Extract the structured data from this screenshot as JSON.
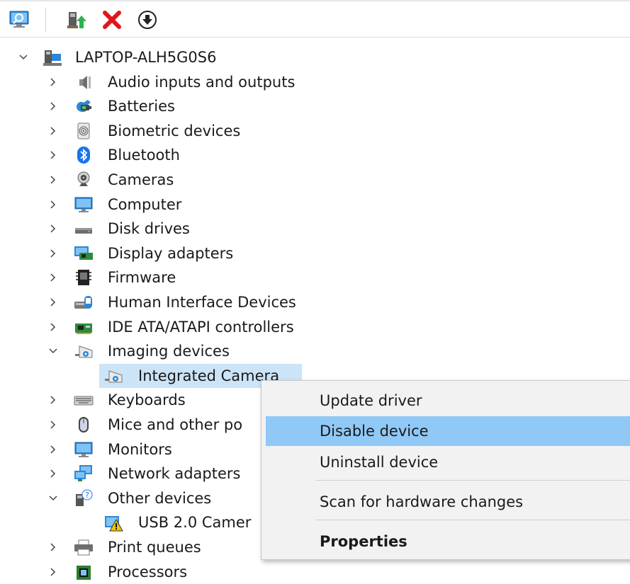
{
  "toolbar": {
    "buttons": [
      {
        "name": "scan-hardware-button",
        "icon": "monitor-magnifier-icon"
      },
      {
        "name": "update-driver-button",
        "icon": "update-driver-icon"
      },
      {
        "name": "uninstall-device-button",
        "icon": "red-x-icon"
      },
      {
        "name": "enable-device-button",
        "icon": "down-arrow-circle-icon"
      }
    ]
  },
  "tree": {
    "root": {
      "label": "LAPTOP-ALH5G0S6",
      "expanded": true,
      "icon": "computer-icon"
    },
    "items": [
      {
        "label": "Audio inputs and outputs",
        "icon": "speaker-icon",
        "expanded": false
      },
      {
        "label": "Batteries",
        "icon": "battery-icon",
        "expanded": false
      },
      {
        "label": "Biometric devices",
        "icon": "fingerprint-icon",
        "expanded": false
      },
      {
        "label": "Bluetooth",
        "icon": "bluetooth-icon",
        "expanded": false
      },
      {
        "label": "Cameras",
        "icon": "webcam-icon",
        "expanded": false
      },
      {
        "label": "Computer",
        "icon": "monitor-icon",
        "expanded": false
      },
      {
        "label": "Disk drives",
        "icon": "disk-drive-icon",
        "expanded": false
      },
      {
        "label": "Display adapters",
        "icon": "display-adapter-icon",
        "expanded": false
      },
      {
        "label": "Firmware",
        "icon": "chip-icon",
        "expanded": false
      },
      {
        "label": "Human Interface Devices",
        "icon": "hid-icon",
        "expanded": false
      },
      {
        "label": "IDE ATA/ATAPI controllers",
        "icon": "controller-card-icon",
        "expanded": false
      },
      {
        "label": "Imaging devices",
        "icon": "imaging-device-icon",
        "expanded": true
      },
      {
        "label": "Integrated Camera",
        "icon": "imaging-device-icon",
        "child": true,
        "selected": true
      },
      {
        "label": "Keyboards",
        "icon": "keyboard-icon",
        "expanded": false
      },
      {
        "label": "Mice and other po",
        "icon": "mouse-icon",
        "expanded": false
      },
      {
        "label": "Monitors",
        "icon": "monitor-icon",
        "expanded": false
      },
      {
        "label": "Network adapters",
        "icon": "network-icon",
        "expanded": false
      },
      {
        "label": "Other devices",
        "icon": "unknown-device-icon",
        "expanded": true
      },
      {
        "label": "USB 2.0 Camer",
        "icon": "warning-device-icon",
        "child": true
      },
      {
        "label": "Print queues",
        "icon": "printer-icon",
        "expanded": false
      },
      {
        "label": "Processors",
        "icon": "processor-icon",
        "expanded": false
      }
    ]
  },
  "context_menu": {
    "items": [
      {
        "label": "Update driver"
      },
      {
        "label": "Disable device",
        "highlighted": true
      },
      {
        "label": "Uninstall device"
      },
      {
        "label": "Scan for hardware changes"
      },
      {
        "label": "Properties",
        "bold": true
      }
    ]
  },
  "colors": {
    "selection": "#cce4f7",
    "menu_highlight": "#90c8f6",
    "menu_bg": "#f2f2f2"
  }
}
